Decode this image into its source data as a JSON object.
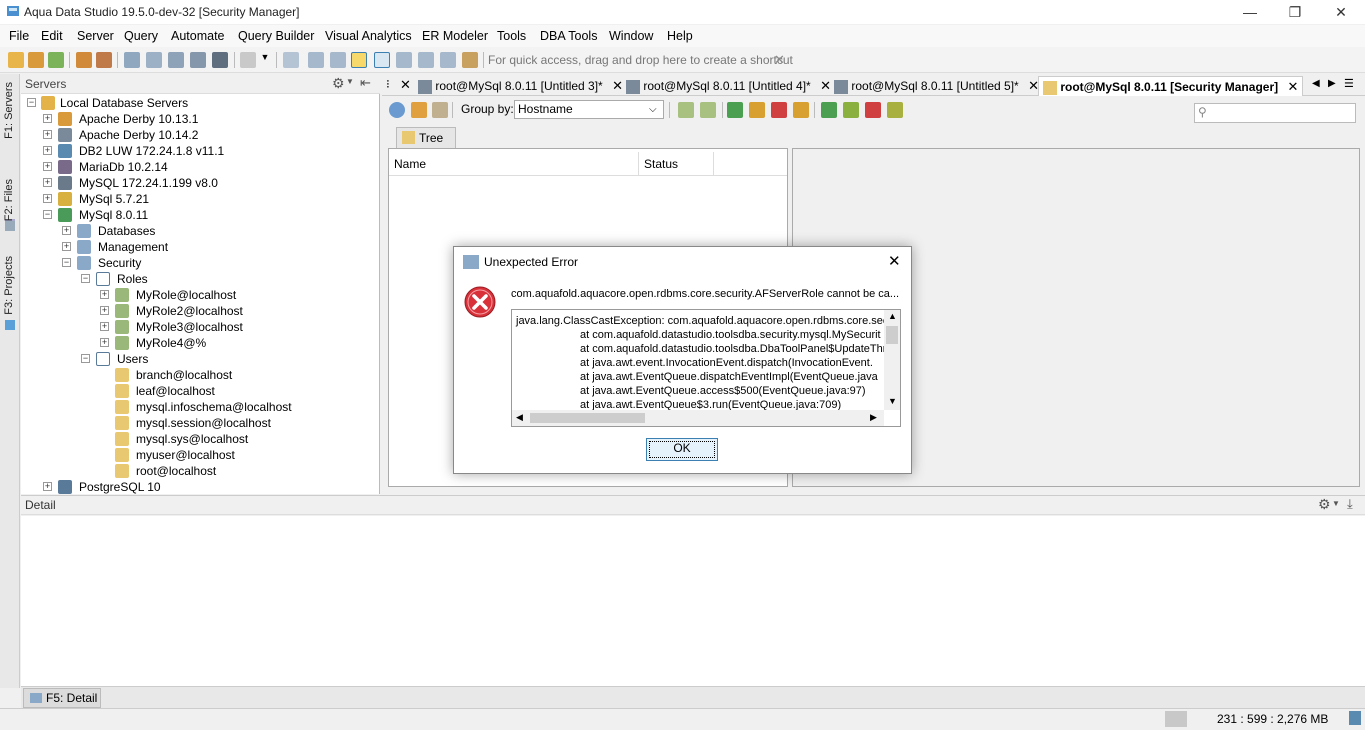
{
  "window": {
    "title": "Aqua Data Studio 19.5.0-dev-32 [Security Manager]",
    "minimize": "—",
    "restore": "❐",
    "close": "✕"
  },
  "menu": [
    "File",
    "Edit",
    "Server",
    "Query",
    "Automate",
    "Query Builder",
    "Visual Analytics",
    "ER Modeler",
    "Tools",
    "DBA Tools",
    "Window",
    "Help"
  ],
  "toolbar": {
    "quick_access": "For quick access, drag and drop here to create a shortcut",
    "quick_access_close": "✕"
  },
  "left_strip": {
    "servers_tab": "F1: Servers",
    "files_tab": "F2: Files",
    "projects_tab": "F3: Projects"
  },
  "servers_panel": {
    "title": "Servers",
    "root": "Local Database Servers",
    "servers": [
      "Apache Derby 10.13.1",
      "Apache Derby 10.14.2",
      "DB2 LUW 172.24.1.8 v11.1",
      "MariaDb 10.2.14",
      "MySQL 172.24.1.199 v8.0",
      "MySql 5.7.21",
      "MySql 8.0.11"
    ],
    "mysql_children": [
      "Databases",
      "Management",
      "Security"
    ],
    "roles_label": "Roles",
    "roles": [
      "MyRole@localhost",
      "MyRole2@localhost",
      "MyRole3@localhost",
      "MyRole4@%"
    ],
    "users_label": "Users",
    "users": [
      "branch@localhost",
      "leaf@localhost",
      "mysql.infoschema@localhost",
      "mysql.session@localhost",
      "mysql.sys@localhost",
      "myuser@localhost",
      "root@localhost"
    ],
    "last_server": "PostgreSQL 10"
  },
  "tabs": {
    "overflow_dots": "⁝",
    "close_symbol": "✕",
    "items": [
      {
        "label": "root@MySql 8.0.11 [Untitled 3]*"
      },
      {
        "label": "root@MySql 8.0.11 [Untitled 4]*"
      },
      {
        "label": "root@MySql 8.0.11 [Untitled 5]*"
      },
      {
        "label": "root@MySql 8.0.11 [Security Manager]"
      }
    ],
    "nav_left": "◀",
    "nav_right": "▶",
    "nav_list": "☰"
  },
  "security_manager": {
    "group_by_label": "Group by:",
    "group_by_value": "Hostname",
    "tree_tab": "Tree",
    "columns": [
      "Name",
      "Status"
    ]
  },
  "detail": {
    "title": "Detail",
    "tab": "F5: Detail"
  },
  "status": {
    "memory": "231 : 599 : 2,276 MB"
  },
  "dialog": {
    "title": "Unexpected Error",
    "message": "com.aquafold.aquacore.open.rdbms.core.security.AFServerRole cannot be ca...",
    "trace": [
      "java.lang.ClassCastException: com.aquafold.aquacore.open.rdbms.core.sec",
      "at com.aquafold.datastudio.toolsdba.security.mysql.MySecurit",
      "at com.aquafold.datastudio.toolsdba.DbaToolPanel$UpdateThr",
      "at java.awt.event.InvocationEvent.dispatch(InvocationEvent.",
      "at java.awt.EventQueue.dispatchEventImpl(EventQueue.java",
      "at java.awt.EventQueue.access$500(EventQueue.java:97)",
      "at java.awt.EventQueue$3.run(EventQueue.java:709)"
    ],
    "ok_label": "OK",
    "close": "✕"
  }
}
